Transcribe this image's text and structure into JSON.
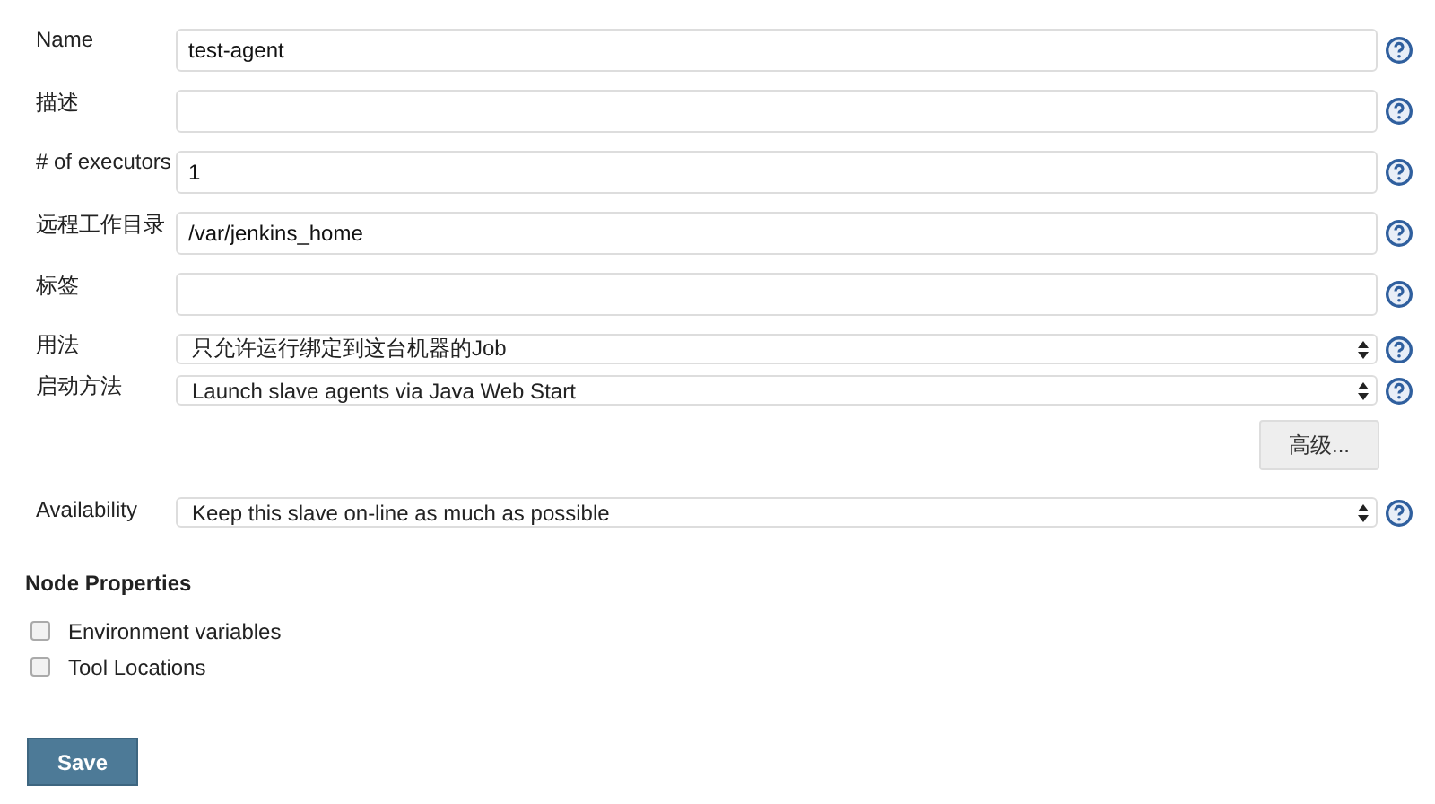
{
  "fields": [
    {
      "kind": "text",
      "label": "Name",
      "value": "test-agent"
    },
    {
      "kind": "text",
      "label": "描述"
    },
    {
      "kind": "text",
      "label": "# of executors",
      "value": "1"
    },
    {
      "kind": "text",
      "label": "远程工作目录",
      "value": "/var/jenkins_home"
    },
    {
      "kind": "text",
      "label": "标签"
    },
    {
      "kind": "select",
      "label": "用法",
      "value": "只允许运行绑定到这台机器的Job"
    },
    {
      "kind": "select",
      "label": "启动方法",
      "value": "Launch slave agents via Java Web Start"
    }
  ],
  "advanced_button": "高级...",
  "availability": {
    "kind": "select",
    "label": "Availability",
    "value": "Keep this slave on-line as much as possible"
  },
  "node_properties": {
    "title": "Node Properties",
    "options": [
      {
        "label": "Environment variables",
        "checked": false
      },
      {
        "label": "Tool Locations",
        "checked": false
      }
    ]
  },
  "save_button": "Save"
}
